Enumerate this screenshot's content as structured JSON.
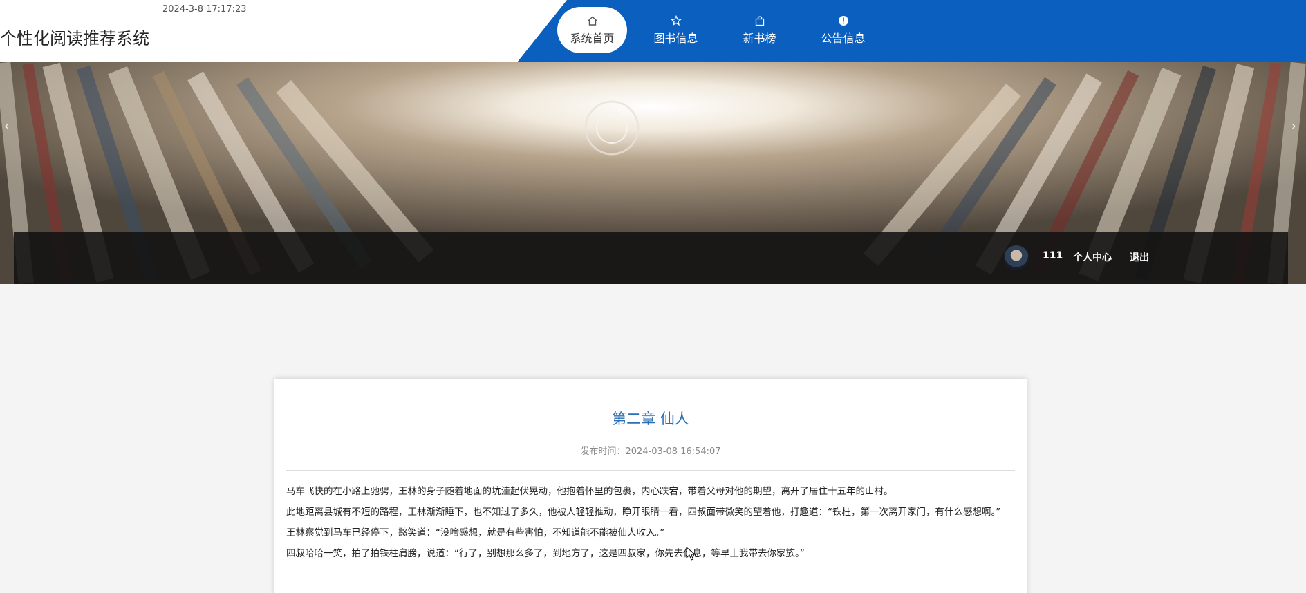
{
  "header": {
    "datetime": "2024-3-8 17:17:23",
    "site_title": "个性化阅读推荐系统",
    "nav": [
      {
        "label": "系统首页",
        "icon": "home-icon",
        "active": true
      },
      {
        "label": "图书信息",
        "icon": "star-icon",
        "active": false
      },
      {
        "label": "新书榜",
        "icon": "bag-icon",
        "active": false
      },
      {
        "label": "公告信息",
        "icon": "info-icon",
        "active": false
      }
    ],
    "colors": {
      "nav_bg": "#0a5fbf"
    }
  },
  "banner": {
    "prev_arrow": "‹",
    "next_arrow": "›",
    "user": {
      "name": "111",
      "center_label": "个人中心",
      "logout_label": "退出"
    }
  },
  "article": {
    "title": "第二章 仙人",
    "publish_time": "发布时间：2024-03-08 16:54:07",
    "paragraphs": [
      "马车飞快的在小路上驰骋，王林的身子随着地面的坑洼起伏晃动，他抱着怀里的包裹，内心跌宕，带着父母对他的期望，离开了居住十五年的山村。",
      "此地距离县城有不短的路程，王林渐渐睡下，也不知过了多久，他被人轻轻推动，睁开眼睛一看，四叔面带微笑的望着他，打趣道：“铁柱，第一次离开家门，有什么感想啊。”",
      "王林察觉到马车已经停下，憨笑道：“没啥感想，就是有些害怕，不知道能不能被仙人收入。”",
      "四叔哈哈一笑，拍了拍铁柱肩膀，说道：“行了，别想那么多了，到地方了，这是四叔家，你先去休息，等早上我带去你家族。”"
    ]
  }
}
